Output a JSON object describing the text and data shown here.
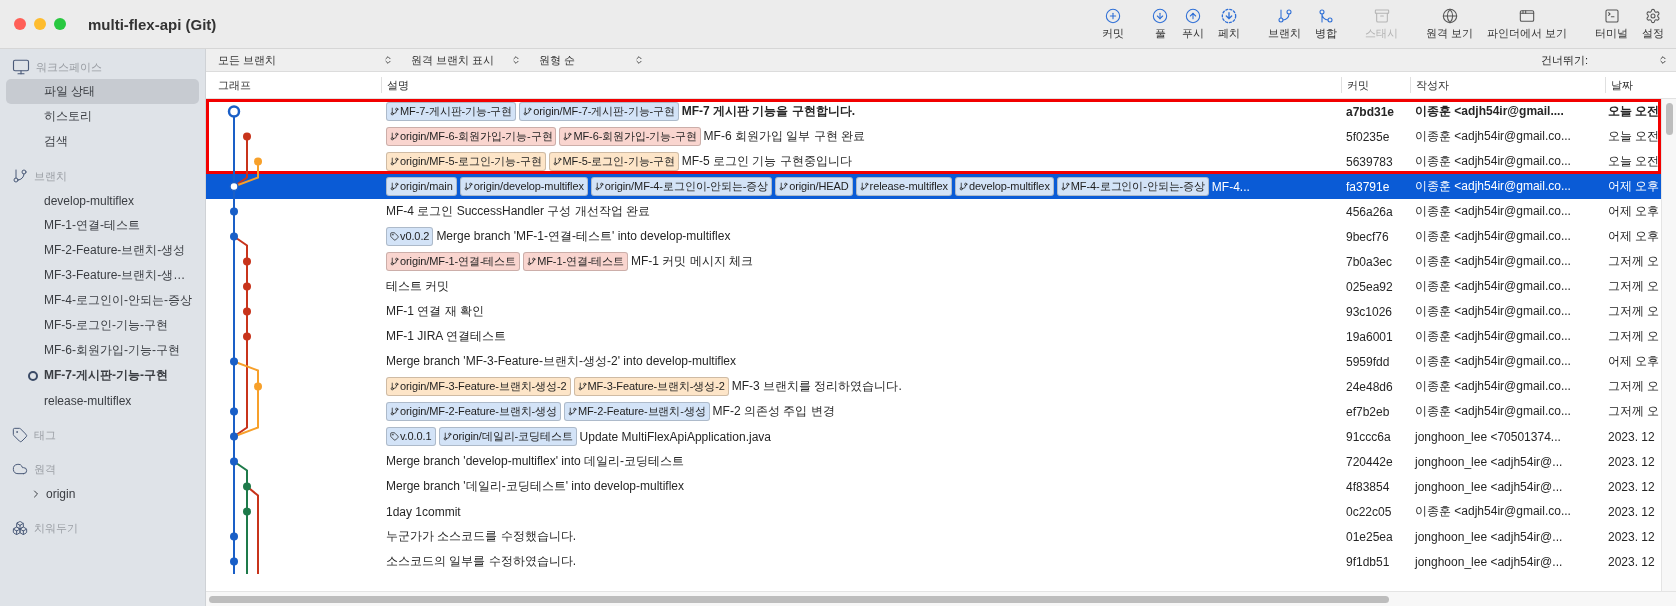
{
  "window": {
    "title": "multi-flex-api (Git)"
  },
  "toolbar_groups": [
    {
      "buttons": [
        {
          "kind": "commit",
          "label": "커밋",
          "disabled": false
        }
      ]
    },
    {
      "buttons": [
        {
          "kind": "pull",
          "label": "풀",
          "disabled": false
        },
        {
          "kind": "push",
          "label": "푸시",
          "disabled": false
        },
        {
          "kind": "fetch",
          "label": "페치",
          "disabled": false
        }
      ]
    },
    {
      "buttons": [
        {
          "kind": "branch",
          "label": "브랜치",
          "disabled": false
        },
        {
          "kind": "merge",
          "label": "병합",
          "disabled": false
        }
      ]
    },
    {
      "buttons": [
        {
          "kind": "stash",
          "label": "스태시",
          "disabled": true
        }
      ]
    },
    {
      "buttons": [
        {
          "kind": "remote",
          "label": "원격 보기",
          "disabled": false
        },
        {
          "kind": "finder",
          "label": "파인더에서 보기",
          "disabled": false
        }
      ]
    },
    {
      "buttons": [
        {
          "kind": "terminal",
          "label": "터미널",
          "disabled": false
        },
        {
          "kind": "settings",
          "label": "설정",
          "disabled": false
        }
      ]
    }
  ],
  "sidebar": {
    "sections": [
      {
        "kind": "workspace",
        "title": "워크스페이스",
        "items": [
          {
            "label": "파일 상태",
            "selected": true
          },
          {
            "label": "히스토리",
            "selected": false
          },
          {
            "label": "검색",
            "selected": false
          }
        ]
      },
      {
        "kind": "branches",
        "title": "브랜치",
        "items": [
          {
            "label": "develop-multiflex",
            "current": false
          },
          {
            "label": "MF-1-연결-테스트",
            "current": false
          },
          {
            "label": "MF-2-Feature-브랜치-생성",
            "current": false
          },
          {
            "label": "MF-3-Feature-브랜치-생…",
            "current": false
          },
          {
            "label": "MF-4-로그인이-안되는-증상",
            "current": false
          },
          {
            "label": "MF-5-로그인-기능-구현",
            "current": false
          },
          {
            "label": "MF-6-회원가입-기능-구현",
            "current": false
          },
          {
            "label": "MF-7-게시판-기능-구현",
            "current": true
          },
          {
            "label": "release-multiflex",
            "current": false
          }
        ]
      },
      {
        "kind": "tags",
        "title": "태그"
      },
      {
        "kind": "remotes",
        "title": "원격",
        "items": [
          {
            "label": "origin",
            "expanded": false
          }
        ]
      },
      {
        "kind": "stashes",
        "title": "치워두기"
      }
    ]
  },
  "filters": [
    {
      "label": "모든 브랜치"
    },
    {
      "label": "원격 브랜치 표시"
    },
    {
      "label": "원형 순"
    }
  ],
  "jump": {
    "label": "건너뛰기:"
  },
  "table": {
    "columns": [
      "그래프",
      "설명",
      "커밋",
      "작성자",
      "날짜"
    ],
    "rows": [
      {
        "refs": [
          {
            "kind": "branch",
            "label": "MF-7-게시판-기능-구현",
            "color": "#d3e3f7"
          },
          {
            "kind": "branch",
            "label": "origin/MF-7-게시판-기능-구현",
            "color": "#d3e3f7"
          }
        ],
        "description": "MF-7 게시판 기능을 구현합니다.",
        "commit": "a7bd31e",
        "author": "이종훈 <adjh54ir@gmail....",
        "date": "오늘 오전",
        "selected": false,
        "current": true,
        "highlighted": true
      },
      {
        "refs": [
          {
            "kind": "branch",
            "label": "origin/MF-6-회원가입-기능-구현",
            "color": "#f9d5cf"
          },
          {
            "kind": "branch",
            "label": "MF-6-회원가입-기능-구현",
            "color": "#f9d5cf"
          }
        ],
        "description": "MF-6 회원가입 일부 구현 완료",
        "commit": "5f0235e",
        "author": "이종훈 <adjh54ir@gmail.co...",
        "date": "오늘 오전",
        "selected": false,
        "current": false,
        "highlighted": true
      },
      {
        "refs": [
          {
            "kind": "branch",
            "label": "origin/MF-5-로그인-기능-구현",
            "color": "#fde5c8"
          },
          {
            "kind": "branch",
            "label": "MF-5-로그인-기능-구현",
            "color": "#fde5c8"
          }
        ],
        "description": "MF-5 로그인 기능 구현중입니다",
        "commit": "5639783",
        "author": "이종훈 <adjh54ir@gmail.co...",
        "date": "오늘 오전",
        "selected": false,
        "current": false,
        "highlighted": true
      },
      {
        "refs": [
          {
            "kind": "branch",
            "label": "origin/main",
            "color": "#d3e3f7"
          },
          {
            "kind": "branch",
            "label": "origin/develop-multiflex",
            "color": "#d3e3f7"
          },
          {
            "kind": "branch",
            "label": "origin/MF-4-로그인이-안되는-증상",
            "color": "#d3e3f7"
          },
          {
            "kind": "branch",
            "label": "origin/HEAD",
            "color": "#d3e3f7"
          },
          {
            "kind": "branch",
            "label": "release-multiflex",
            "color": "#d3e3f7"
          },
          {
            "kind": "branch",
            "label": "develop-multiflex",
            "color": "#d3e3f7"
          },
          {
            "kind": "branch",
            "label": "MF-4-로그인이-안되는-증상",
            "color": "#d3e3f7"
          }
        ],
        "description": "MF-4...",
        "commit": "fa3791e",
        "author": "이종훈 <adjh54ir@gmail.co...",
        "date": "어제 오후",
        "selected": true,
        "current": false,
        "highlighted": false
      },
      {
        "refs": [],
        "description": "MF-4 로그인 SuccessHandler 구성 개선작업 완료",
        "commit": "456a26a",
        "author": "이종훈 <adjh54ir@gmail.co...",
        "date": "어제 오후",
        "selected": false,
        "current": false,
        "highlighted": false
      },
      {
        "refs": [
          {
            "kind": "tag",
            "label": "v0.0.2",
            "color": "#d3e3f7"
          }
        ],
        "description": "Merge branch 'MF-1-연결-테스트' into develop-multiflex",
        "commit": "9becf76",
        "author": "이종훈 <adjh54ir@gmail.co...",
        "date": "어제 오후",
        "selected": false,
        "current": false,
        "highlighted": false
      },
      {
        "refs": [
          {
            "kind": "branch",
            "label": "origin/MF-1-연결-테스트",
            "color": "#f9d5cf"
          },
          {
            "kind": "branch",
            "label": "MF-1-연결-테스트",
            "color": "#f9d5cf"
          }
        ],
        "description": "MF-1 커밋 메시지 체크",
        "commit": "7b0a3ec",
        "author": "이종훈 <adjh54ir@gmail.co...",
        "date": "그저께 오",
        "selected": false,
        "current": false,
        "highlighted": false
      },
      {
        "refs": [],
        "description": "테스트 커밋",
        "commit": "025ea92",
        "author": "이종훈 <adjh54ir@gmail.co...",
        "date": "그저께 오",
        "selected": false,
        "current": false,
        "highlighted": false
      },
      {
        "refs": [],
        "description": "MF-1 연결 재 확인",
        "commit": "93c1026",
        "author": "이종훈 <adjh54ir@gmail.co...",
        "date": "그저께 오",
        "selected": false,
        "current": false,
        "highlighted": false
      },
      {
        "refs": [],
        "description": "MF-1 JIRA 연결테스트",
        "commit": "19a6001",
        "author": "이종훈 <adjh54ir@gmail.co...",
        "date": "그저께 오",
        "selected": false,
        "current": false,
        "highlighted": false
      },
      {
        "refs": [],
        "description": "Merge branch 'MF-3-Feature-브랜치-생성-2' into develop-multiflex",
        "commit": "5959fdd",
        "author": "이종훈 <adjh54ir@gmail.co...",
        "date": "어제 오후",
        "selected": false,
        "current": false,
        "highlighted": false
      },
      {
        "refs": [
          {
            "kind": "branch",
            "label": "origin/MF-3-Feature-브랜치-생성-2",
            "color": "#fde5c8"
          },
          {
            "kind": "branch",
            "label": "MF-3-Feature-브랜치-생성-2",
            "color": "#fde5c8"
          }
        ],
        "description": "MF-3 브랜치를 정리하였습니다.",
        "commit": "24e48d6",
        "author": "이종훈 <adjh54ir@gmail.co...",
        "date": "그저께 오",
        "selected": false,
        "current": false,
        "highlighted": false
      },
      {
        "refs": [
          {
            "kind": "branch",
            "label": "origin/MF-2-Feature-브랜치-생성",
            "color": "#d3e3f7"
          },
          {
            "kind": "branch",
            "label": "MF-2-Feature-브랜치-생성",
            "color": "#d3e3f7"
          }
        ],
        "description": "MF-2 의존성 주입 변경",
        "commit": "ef7b2eb",
        "author": "이종훈 <adjh54ir@gmail.co...",
        "date": "그저께 오",
        "selected": false,
        "current": false,
        "highlighted": false
      },
      {
        "refs": [
          {
            "kind": "tag",
            "label": "v.0.0.1",
            "color": "#d3e3f7"
          },
          {
            "kind": "branch",
            "label": "origin/데일리-코딩테스트",
            "color": "#d3e3f7"
          }
        ],
        "description": "Update MultiFlexApiApplication.java",
        "commit": "91ccc6a",
        "author": "jonghoon_lee <70501374...",
        "date": "2023. 12",
        "selected": false,
        "current": false,
        "highlighted": false
      },
      {
        "refs": [],
        "description": "Merge branch 'develop-multiflex' into 데일리-코딩테스트",
        "commit": "720442e",
        "author": "jonghoon_lee <adjh54ir@...",
        "date": "2023. 12",
        "selected": false,
        "current": false,
        "highlighted": false
      },
      {
        "refs": [],
        "description": "Merge branch '데일리-코딩테스트' into develop-multiflex",
        "commit": "4f83854",
        "author": "jonghoon_lee <adjh54ir@...",
        "date": "2023. 12",
        "selected": false,
        "current": false,
        "highlighted": false
      },
      {
        "refs": [],
        "description": "1day 1commit",
        "commit": "0c22c05",
        "author": "이종훈 <adjh54ir@gmail.co...",
        "date": "2023. 12",
        "selected": false,
        "current": false,
        "highlighted": false
      },
      {
        "refs": [],
        "description": "누군가가 소스코드를 수정했습니다.",
        "commit": "01e25ea",
        "author": "jonghoon_lee <adjh54ir@...",
        "date": "2023. 12",
        "selected": false,
        "current": false,
        "highlighted": false
      },
      {
        "refs": [],
        "description": "소스코드의 일부를 수정하였습니다.",
        "commit": "9f1db51",
        "author": "jonghoon_lee <adjh54ir@...",
        "date": "2023. 12",
        "selected": false,
        "current": false,
        "highlighted": false
      }
    ]
  }
}
